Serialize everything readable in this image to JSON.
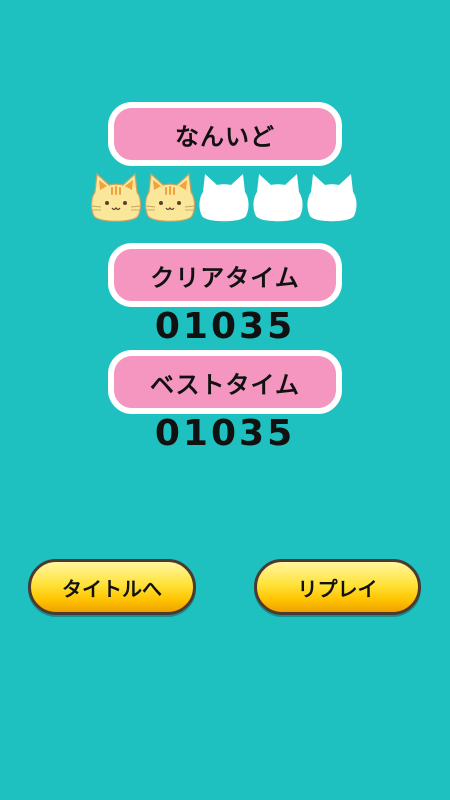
{
  "difficulty": {
    "label": "なんいど",
    "level": 2,
    "max_level": 5,
    "cat_icon": "cat-face-icon"
  },
  "clear_time": {
    "label": "クリアタイム",
    "value": "01035"
  },
  "best_time": {
    "label": "ベストタイム",
    "value": "01035"
  },
  "buttons": {
    "title": "タイトルへ",
    "replay": "リプレイ"
  },
  "colors": {
    "background": "#1fc0c0",
    "label_pill": "#f496c0",
    "button_yellow": "#ffd21a"
  }
}
